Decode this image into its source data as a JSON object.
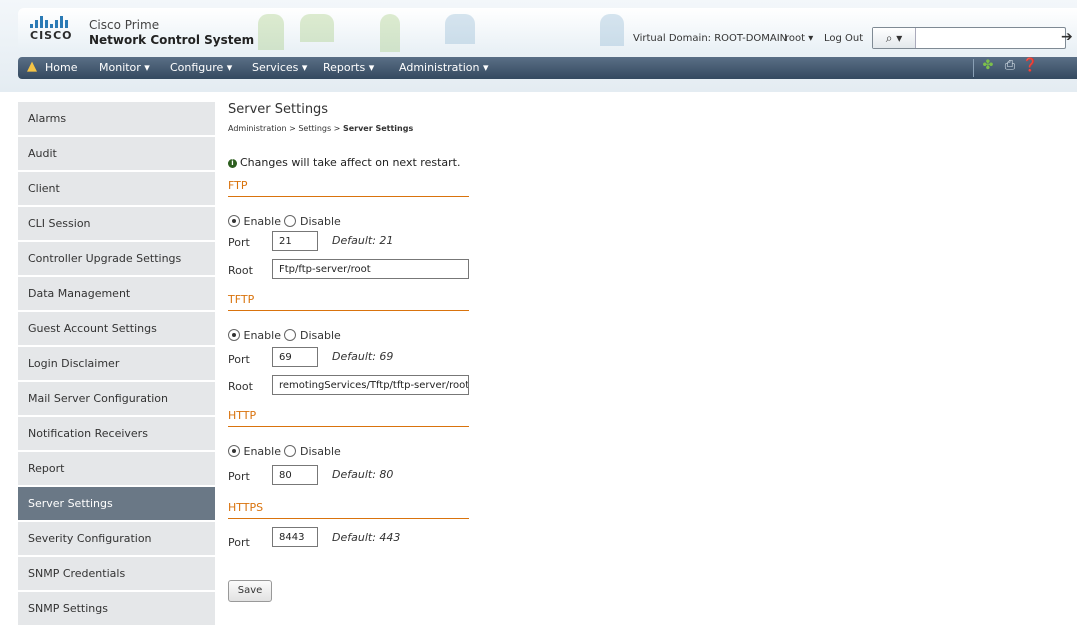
{
  "header": {
    "logo_text": "CISCO",
    "app_name_line1": "Cisco Prime",
    "app_name_line2": "Network Control System",
    "virtual_domain": "Virtual Domain: ROOT-DOMAIN",
    "user": "root ▾",
    "logout": "Log Out",
    "search_icon": "⌕ ▾",
    "go_icon": "➔"
  },
  "nav": {
    "items": [
      "Home",
      "Monitor ▾",
      "Configure ▾",
      "Services ▾",
      "Reports ▾",
      "Administration ▾"
    ],
    "tools": [
      "✤",
      "⎙",
      "❓"
    ]
  },
  "sidebar": {
    "items": [
      "Alarms",
      "Audit",
      "Client",
      "CLI Session",
      "Controller Upgrade Settings",
      "Data Management",
      "Guest Account Settings",
      "Login Disclaimer",
      "Mail Server Configuration",
      "Notification Receivers",
      "Report",
      "Server Settings",
      "Severity Configuration",
      "SNMP Credentials",
      "SNMP Settings"
    ],
    "active_index": 11
  },
  "main": {
    "title": "Server Settings",
    "breadcrumb_prefix": "Administration > Settings > ",
    "breadcrumb_current": "Server Settings",
    "notice_icon": "i",
    "notice": "Changes will take affect on next restart.",
    "enable_label": "Enable",
    "disable_label": "Disable",
    "port_label": "Port",
    "root_label": "Root",
    "ftp": {
      "heading": "FTP",
      "port": "21",
      "default": "Default: 21",
      "root": "Ftp/ftp-server/root"
    },
    "tftp": {
      "heading": "TFTP",
      "port": "69",
      "default": "Default: 69",
      "root": "remotingServices/Tftp/tftp-server/root"
    },
    "http": {
      "heading": "HTTP",
      "port": "80",
      "default": "Default: 80"
    },
    "https": {
      "heading": "HTTPS",
      "port": "8443",
      "default": "Default: 443"
    },
    "save_label": "Save"
  },
  "colors": {
    "accent": "#d9730d",
    "nav": "#3f546b",
    "sidebar_active": "#6a7886"
  }
}
